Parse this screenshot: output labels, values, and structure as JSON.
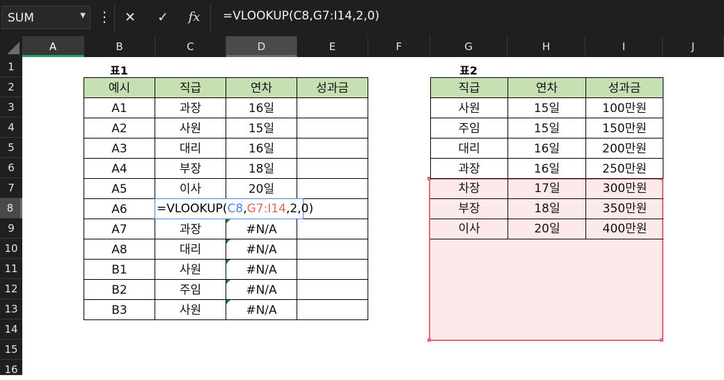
{
  "formula_bar": {
    "name_box": "SUM",
    "cancel_icon": "✕",
    "enter_icon": "✓",
    "fx_label": "fx",
    "formula": "=VLOOKUP(C8,G7:I14,2,0)"
  },
  "columns": [
    "A",
    "B",
    "C",
    "D",
    "E",
    "F",
    "G",
    "H",
    "I",
    "J"
  ],
  "rows": [
    "1",
    "2",
    "3",
    "4",
    "5",
    "6",
    "7",
    "8",
    "9",
    "10",
    "11",
    "12",
    "13",
    "14",
    "15",
    "16"
  ],
  "table1": {
    "title": "표1",
    "headers": [
      "예시",
      "직급",
      "연차",
      "성과금"
    ],
    "rows": [
      [
        "A1",
        "과장",
        "16일",
        ""
      ],
      [
        "A2",
        "사원",
        "15일",
        ""
      ],
      [
        "A3",
        "대리",
        "16일",
        ""
      ],
      [
        "A4",
        "부장",
        "18일",
        ""
      ],
      [
        "A5",
        "이사",
        "20일",
        ""
      ],
      [
        "A6",
        "",
        "",
        ""
      ],
      [
        "A7",
        "과장",
        "#N/A",
        ""
      ],
      [
        "A8",
        "대리",
        "#N/A",
        ""
      ],
      [
        "B1",
        "사원",
        "#N/A",
        ""
      ],
      [
        "B2",
        "주임",
        "#N/A",
        ""
      ],
      [
        "B3",
        "사원",
        "#N/A",
        ""
      ]
    ],
    "editing": {
      "prefix": "=VLOOKUP(",
      "ref1": "C8",
      "comma1": ",",
      "ref2": "G7:I14",
      "suffix": ",2,0)"
    }
  },
  "table2": {
    "title": "표2",
    "headers": [
      "직급",
      "연차",
      "성과금"
    ],
    "rows": [
      [
        "사원",
        "15일",
        "100만원"
      ],
      [
        "주임",
        "15일",
        "150만원"
      ],
      [
        "대리",
        "16일",
        "200만원"
      ],
      [
        "과장",
        "16일",
        "250만원"
      ],
      [
        "차장",
        "17일",
        "300만원"
      ],
      [
        "부장",
        "18일",
        "350만원"
      ],
      [
        "이사",
        "20일",
        "400만원"
      ]
    ]
  },
  "colors": {
    "header_fill": "#c6e0b4",
    "selection_green": "#21a366",
    "range_red": "#e06a7a",
    "range_blue": "#4a86e8"
  }
}
